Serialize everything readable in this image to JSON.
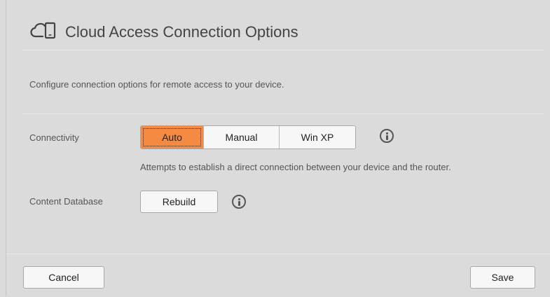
{
  "dialog": {
    "title": "Cloud Access Connection Options",
    "title_icon": "cloud-devices-icon",
    "description": "Configure connection options for remote access to your device."
  },
  "connectivity": {
    "label": "Connectivity",
    "options": [
      "Auto",
      "Manual",
      "Win XP"
    ],
    "selected": "Auto",
    "selected_color": "#f58a43",
    "hint": "Attempts to establish a direct connection between your device and the router.",
    "info_icon": "info-icon"
  },
  "content_database": {
    "label": "Content Database",
    "button_label": "Rebuild",
    "info_icon": "info-icon"
  },
  "footer": {
    "cancel_label": "Cancel",
    "save_label": "Save"
  }
}
